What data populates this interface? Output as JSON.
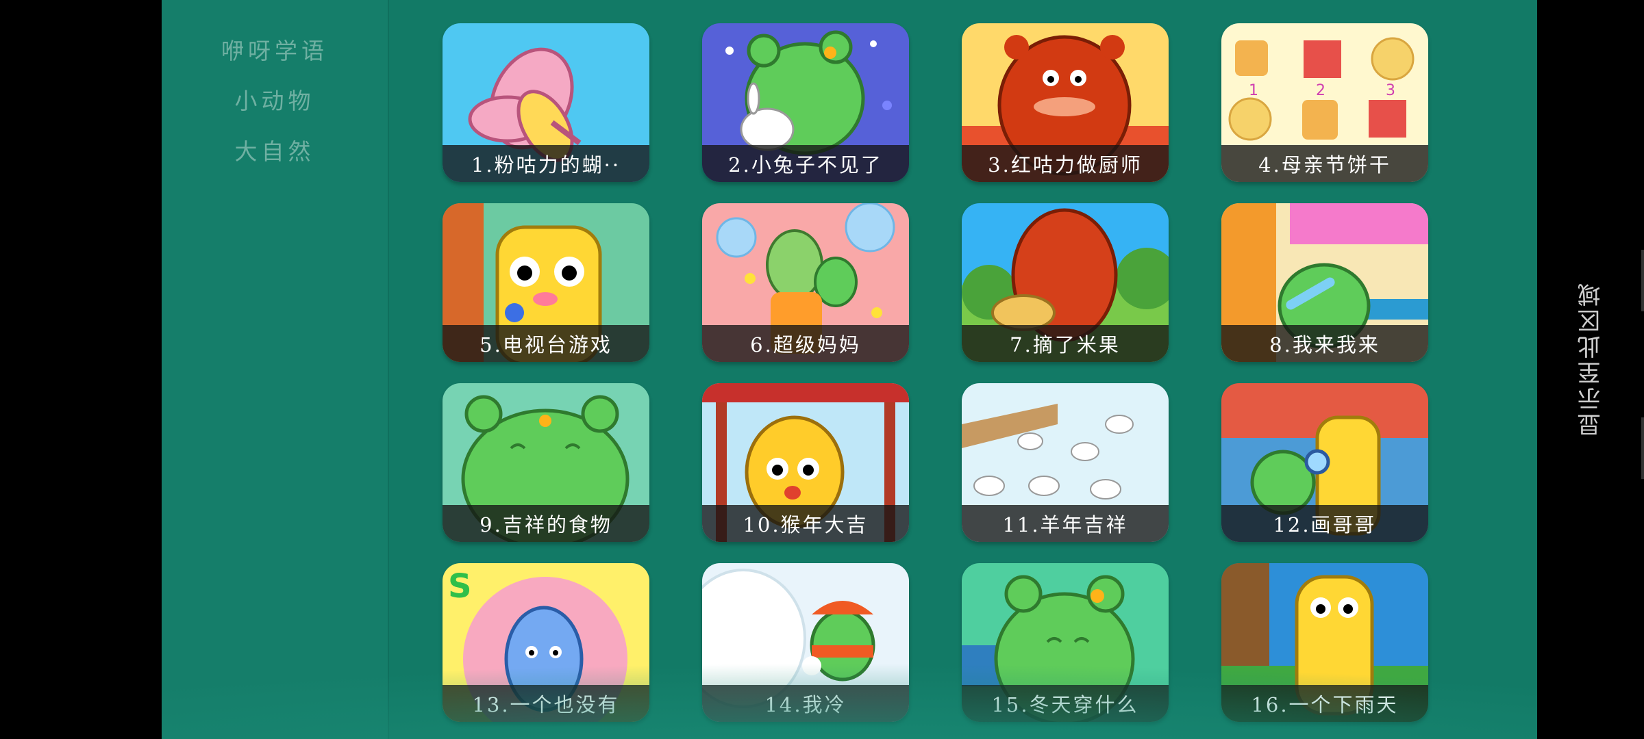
{
  "sidebar": {
    "categories": [
      {
        "label": "咿呀学语"
      },
      {
        "label": "小动物"
      },
      {
        "label": "大自然"
      }
    ]
  },
  "episodes": [
    {
      "title": "1.粉咕力的蝴··",
      "icon": "butterfly"
    },
    {
      "title": "2.小兔子不见了",
      "icon": "bunny"
    },
    {
      "title": "3.红咕力做厨师",
      "icon": "red-monster"
    },
    {
      "title": "4.母亲节饼干",
      "icon": "cookies"
    },
    {
      "title": "5.电视台游戏",
      "icon": "yellow-monster"
    },
    {
      "title": "6.超级妈妈",
      "icon": "bubbles"
    },
    {
      "title": "7.摘了米果",
      "icon": "red-monster-basket"
    },
    {
      "title": "8.我来我来",
      "icon": "green-monster-wash"
    },
    {
      "title": "9.吉祥的食物",
      "icon": "green-monster"
    },
    {
      "title": "10.猴年大吉",
      "icon": "tiger-costume"
    },
    {
      "title": "11.羊年吉祥",
      "icon": "sheep"
    },
    {
      "title": "12.画哥哥",
      "icon": "magnifier"
    },
    {
      "title": "13.一个也没有",
      "icon": "blue-monster"
    },
    {
      "title": "14.我冷",
      "icon": "snow-monster"
    },
    {
      "title": "15.冬天穿什么",
      "icon": "green-monster-winter"
    },
    {
      "title": "16.一个下雨天",
      "icon": "rain-monster"
    }
  ],
  "right_panel": {
    "label": "显示至此区域"
  },
  "colors": {
    "background": "#127a66",
    "sidebar": "#157e6a",
    "caption_bg": "#141414"
  }
}
